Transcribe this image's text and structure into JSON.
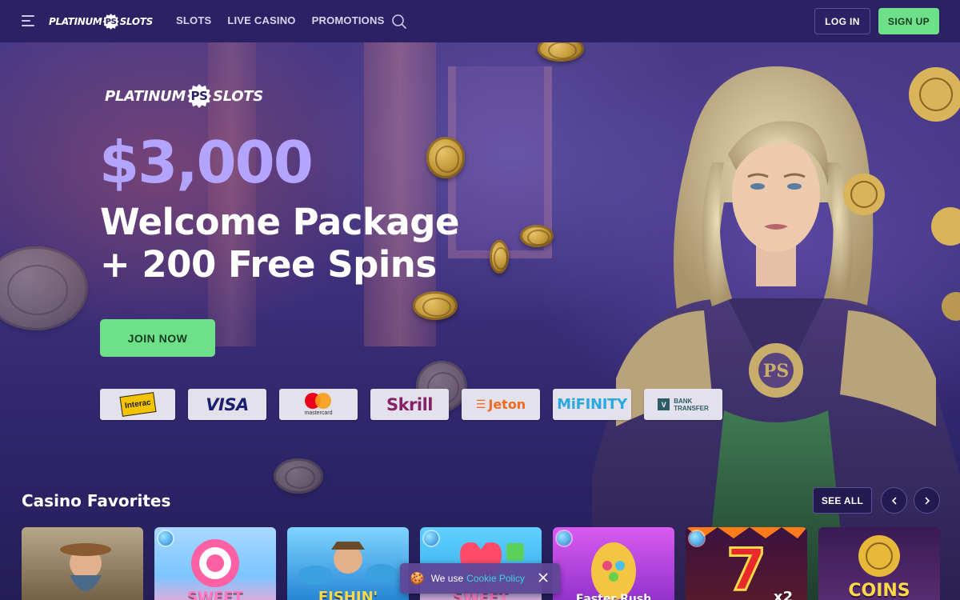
{
  "brand": {
    "logo_left": "PLATINUM",
    "logo_mark": "PS",
    "logo_right": "SLOTS"
  },
  "nav": {
    "items": [
      {
        "label": "SLOTS"
      },
      {
        "label": "LIVE CASINO"
      },
      {
        "label": "PROMOTIONS"
      }
    ]
  },
  "header": {
    "login_label": "LOG IN",
    "signup_label": "SIGN UP"
  },
  "hero": {
    "amount": "$3,000",
    "headline_line1": "Welcome Package",
    "headline_line2": "+ 200 Free Spins",
    "cta_label": "JOIN NOW"
  },
  "payments": {
    "interac": "Interac",
    "visa": "VISA",
    "mastercard": "mastercard",
    "skrill": "Skrill",
    "jeton": "Jeton",
    "mifinity": "MiFINITY",
    "bank_line1": "BANK",
    "bank_line2": "TRANSFER"
  },
  "favorites": {
    "title": "Casino Favorites",
    "see_all_label": "SEE ALL",
    "games": [
      {
        "title": ""
      },
      {
        "title": "SWEET"
      },
      {
        "title": "FISHIN'"
      },
      {
        "title": "SWEET"
      },
      {
        "title": "Easter Rush"
      },
      {
        "title": "x2"
      },
      {
        "title": "COINS"
      }
    ]
  },
  "cookie": {
    "text": "We use",
    "link": "Cookie Policy"
  },
  "colors": {
    "header_bg": "#2b2164",
    "accent_green": "#6fe08a",
    "amount_purple": "#b3a4ff",
    "cookie_link": "#39d6e0"
  },
  "icons": {
    "menu": "menu-icon",
    "search": "search-icon",
    "prev": "chevron-left-icon",
    "next": "chevron-right-icon",
    "cookie": "cookie-icon",
    "close": "close-icon"
  }
}
